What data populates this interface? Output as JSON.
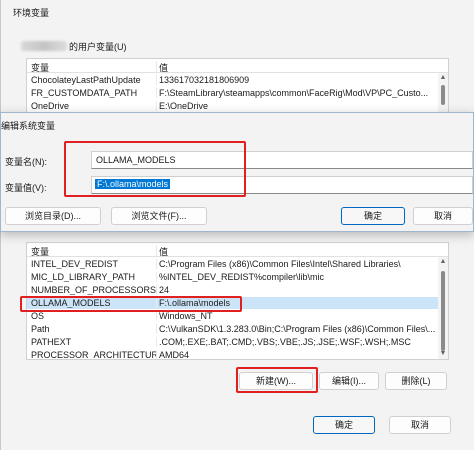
{
  "env_window": {
    "title": "环境变量",
    "user_group_label": "的用户变量(U)",
    "user_table": {
      "headers": [
        "变量",
        "值"
      ],
      "rows": [
        [
          "ChocolateyLastPathUpdate",
          "133617032181806909"
        ],
        [
          "FR_CUSTOMDATA_PATH",
          "F:\\SteamLibrary\\steamapps\\common\\FaceRig\\Mod\\VP\\PC_Custo..."
        ],
        [
          "OneDrive",
          "E:\\OneDrive"
        ]
      ]
    },
    "system_table": {
      "headers": [
        "变量",
        "值"
      ],
      "rows": [
        [
          "INTEL_DEV_REDIST",
          "C:\\Program Files (x86)\\Common Files\\Intel\\Shared Libraries\\"
        ],
        [
          "MIC_LD_LIBRARY_PATH",
          "%INTEL_DEV_REDIST%compiler\\lib\\mic"
        ],
        [
          "NUMBER_OF_PROCESSORS",
          "24"
        ],
        [
          "OLLAMA_MODELS",
          "F:\\.ollama\\models"
        ],
        [
          "OS",
          "Windows_NT"
        ],
        [
          "Path",
          "C:\\VulkanSDK\\1.3.283.0\\Bin;C:\\Program Files (x86)\\Common Files\\..."
        ],
        [
          "PATHEXT",
          ".COM;.EXE;.BAT;.CMD;.VBS;.VBE;.JS;.JSE;.WSF;.WSH;.MSC"
        ],
        [
          "PROCESSOR_ARCHITECTURE",
          "AMD64"
        ]
      ]
    },
    "buttons": {
      "new": "新建(W)...",
      "edit": "编辑(I)...",
      "delete": "删除(L)",
      "ok": "确定",
      "cancel": "取消"
    }
  },
  "edit_dialog": {
    "title": "编辑系统变量",
    "name_label": "变量名(N):",
    "value_label": "变量值(V):",
    "name_value": "OLLAMA_MODELS",
    "value_value": "F:\\.ollama\\models",
    "buttons": {
      "browse_dir": "浏览目录(D)...",
      "browse_file": "浏览文件(F)...",
      "ok": "确定",
      "cancel": "取消"
    }
  },
  "colors": {
    "annotation_red": "#e02020",
    "selection_blue": "#0078d4",
    "row_highlight": "#cce4f7"
  }
}
